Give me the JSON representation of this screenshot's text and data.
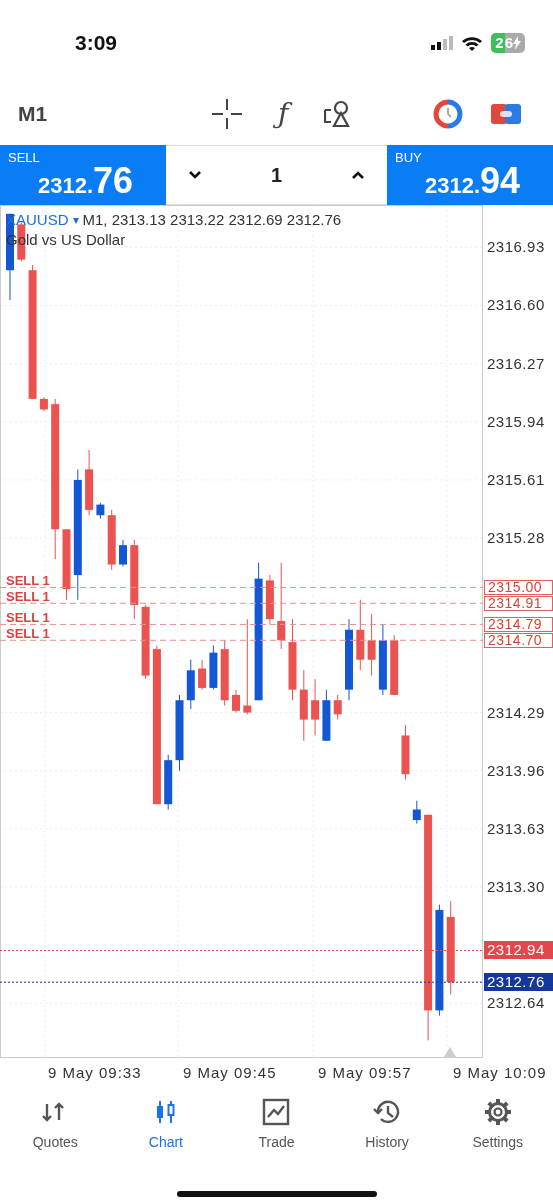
{
  "status_bar": {
    "time": "3:09",
    "battery": "26"
  },
  "toolbar": {
    "timeframe": "M1",
    "function_glyph": "ƒ"
  },
  "trade_bar": {
    "sell": {
      "label": "SELL",
      "price": "2312.76"
    },
    "volume": "1",
    "buy": {
      "label": "BUY",
      "price": "2312.94"
    }
  },
  "chart": {
    "symbol": "XAUUSD",
    "dropdown": "▾",
    "ohlc": "M1, 2313.13 2313.22 2312.69 2312.76",
    "description": "Gold vs US Dollar",
    "chart_data": {
      "type": "candlestick",
      "ylim": [
        2312.33,
        2317.17
      ],
      "grid": true,
      "ref_lines": [
        {
          "axis": "y",
          "value": 2315.0,
          "label": "SELL 1",
          "color": "#e89090"
        },
        {
          "axis": "y",
          "value": 2314.91,
          "label": "SELL 1",
          "color": "#e89090"
        },
        {
          "axis": "y",
          "value": 2314.79,
          "label": "SELL 1",
          "color": "#e89090"
        },
        {
          "axis": "y",
          "value": 2314.7,
          "label": "SELL 1",
          "color": "#e89090"
        },
        {
          "axis": "y",
          "value": 2312.94,
          "color": "#e4474b"
        },
        {
          "axis": "y",
          "value": 2312.76,
          "color": "#14389a"
        }
      ],
      "categories": [
        null,
        null,
        null,
        null,
        null,
        null,
        null,
        null,
        null,
        null,
        null,
        null,
        null,
        null,
        null,
        null,
        null,
        null,
        null,
        null,
        null,
        null,
        null,
        null,
        null,
        null,
        null,
        null,
        null,
        null,
        null,
        null,
        null,
        null,
        null,
        null,
        null,
        null,
        null,
        null
      ],
      "yticks": [
        {
          "value": 2316.93,
          "label": "2316.93"
        },
        {
          "value": 2316.6,
          "label": "2316.60"
        },
        {
          "value": 2316.27,
          "label": "2316.27"
        },
        {
          "value": 2315.94,
          "label": "2315.94"
        },
        {
          "value": 2315.61,
          "label": "2315.61"
        },
        {
          "value": 2315.28,
          "label": "2315.28"
        },
        {
          "value": 2314.29,
          "label": "2314.29"
        },
        {
          "value": 2313.96,
          "label": "2313.96"
        },
        {
          "value": 2313.63,
          "label": "2313.63"
        },
        {
          "value": 2313.3,
          "label": "2313.30"
        },
        {
          "value": 2312.64,
          "label": "2312.64"
        }
      ],
      "ohlc": [
        [
          2316.8,
          2317.12,
          2316.63,
          2317.12
        ],
        [
          2317.06,
          2317.07,
          2316.85,
          2316.86
        ],
        [
          2316.8,
          2316.83,
          2316.07,
          2316.07
        ],
        [
          2316.07,
          2316.08,
          2316.0,
          2316.01
        ],
        [
          2316.04,
          2316.07,
          2315.16,
          2315.33
        ],
        [
          2315.33,
          2315.33,
          2314.93,
          2314.99
        ],
        [
          2315.07,
          2315.67,
          2314.93,
          2315.61
        ],
        [
          2315.67,
          2315.78,
          2315.41,
          2315.44
        ],
        [
          2315.41,
          2315.48,
          2315.39,
          2315.47
        ],
        [
          2315.41,
          2315.44,
          2315.1,
          2315.13
        ],
        [
          2315.13,
          2315.27,
          2315.12,
          2315.24
        ],
        [
          2315.24,
          2315.27,
          2314.82,
          2314.9
        ],
        [
          2314.89,
          2314.9,
          2314.48,
          2314.5
        ],
        [
          2314.65,
          2314.67,
          2313.77,
          2313.77
        ],
        [
          2313.77,
          2314.05,
          2313.74,
          2314.02
        ],
        [
          2314.02,
          2314.39,
          2313.96,
          2314.36
        ],
        [
          2314.36,
          2314.59,
          2314.31,
          2314.53
        ],
        [
          2314.54,
          2314.59,
          2314.42,
          2314.43
        ],
        [
          2314.43,
          2314.67,
          2314.42,
          2314.63
        ],
        [
          2314.65,
          2314.7,
          2314.33,
          2314.36
        ],
        [
          2314.39,
          2314.42,
          2314.29,
          2314.3
        ],
        [
          2314.33,
          2314.82,
          2314.28,
          2314.29
        ],
        [
          2314.36,
          2315.14,
          2314.36,
          2315.05
        ],
        [
          2315.04,
          2315.07,
          2314.79,
          2314.82
        ],
        [
          2314.81,
          2315.14,
          2314.65,
          2314.7
        ],
        [
          2314.69,
          2314.82,
          2314.36,
          2314.42
        ],
        [
          2314.42,
          2314.53,
          2314.13,
          2314.25
        ],
        [
          2314.36,
          2314.48,
          2314.16,
          2314.25
        ],
        [
          2314.13,
          2314.42,
          2314.13,
          2314.36
        ],
        [
          2314.36,
          2314.39,
          2314.25,
          2314.28
        ],
        [
          2314.42,
          2314.82,
          2314.36,
          2314.76
        ],
        [
          2314.76,
          2314.93,
          2314.53,
          2314.59
        ],
        [
          2314.7,
          2314.85,
          2314.5,
          2314.59
        ],
        [
          2314.42,
          2314.79,
          2314.39,
          2314.7
        ],
        [
          2314.7,
          2314.73,
          2314.39,
          2314.39
        ],
        [
          2314.16,
          2314.22,
          2313.91,
          2313.94
        ],
        [
          2313.68,
          2313.79,
          2313.66,
          2313.74
        ],
        [
          2313.71,
          2313.71,
          2312.43,
          2312.6
        ],
        [
          2312.6,
          2313.2,
          2312.57,
          2313.17
        ],
        [
          2313.13,
          2313.22,
          2312.69,
          2312.76
        ]
      ]
    },
    "price_tags": [
      {
        "kind": "order",
        "text": "2315.00"
      },
      {
        "kind": "order",
        "text": "2314.91"
      },
      {
        "kind": "order",
        "text": "2314.79"
      },
      {
        "kind": "order",
        "text": "2314.70"
      },
      {
        "kind": "ask",
        "text": "2312.94"
      },
      {
        "kind": "bid",
        "text": "2312.76"
      }
    ],
    "time_labels": [
      "9 May 09:33",
      "9 May 09:45",
      "9 May 09:57",
      "9 May 10:09"
    ]
  },
  "tabs": [
    {
      "label": "Quotes",
      "kind": "quotes",
      "selected": false
    },
    {
      "label": "Chart",
      "kind": "chart",
      "selected": true
    },
    {
      "label": "Trade",
      "kind": "trade",
      "selected": false
    },
    {
      "label": "History",
      "kind": "history",
      "selected": false
    },
    {
      "label": "Settings",
      "kind": "settings",
      "selected": false
    }
  ]
}
